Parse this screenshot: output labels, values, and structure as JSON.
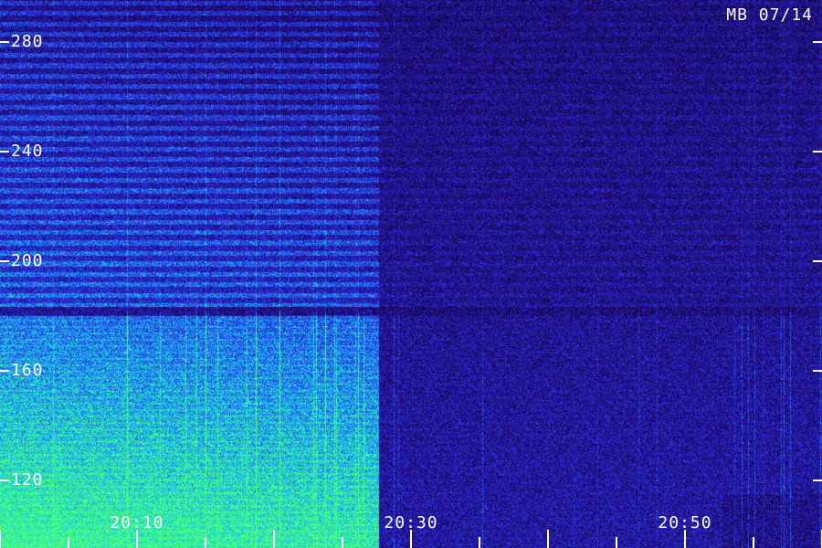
{
  "station_label": "MB 07/14",
  "y_axis": {
    "ticks": [
      {
        "value": 280,
        "label": "280"
      },
      {
        "value": 240,
        "label": "240"
      },
      {
        "value": 200,
        "label": "200"
      },
      {
        "value": 160,
        "label": "160"
      },
      {
        "value": 120,
        "label": "120"
      }
    ],
    "range": [
      100,
      295
    ]
  },
  "x_axis": {
    "labels": [
      {
        "value": "20:10",
        "label": "20:10"
      },
      {
        "value": "20:30",
        "label": "20:30"
      },
      {
        "value": "20:50",
        "label": "20:50"
      }
    ],
    "range_minutes_label": [
      "20:00",
      "21:00"
    ]
  },
  "colors": {
    "background": "#1a0a48",
    "low": "#2a10a0",
    "mid": "#2060ff",
    "high": "#20f0d0",
    "peak": "#40ff80",
    "text": "#ffffff"
  }
}
